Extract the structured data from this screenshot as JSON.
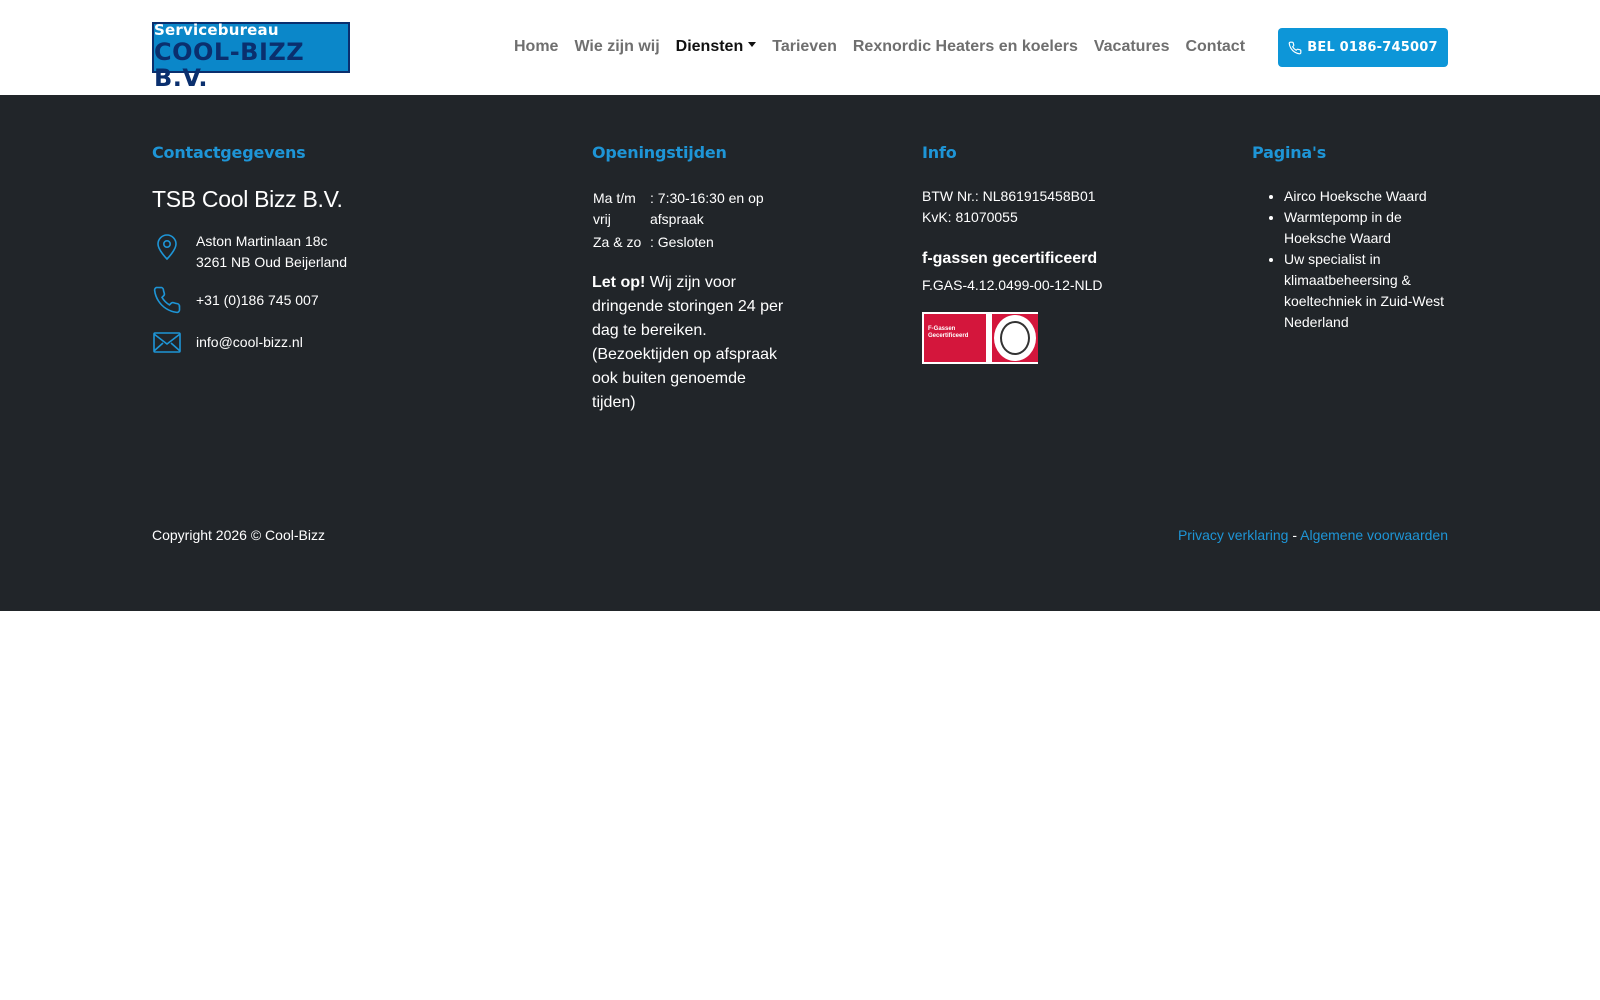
{
  "header": {
    "logo": {
      "line1": "Technisch Servicebureau",
      "line2": "COOL-BIZZ B.V."
    },
    "nav": [
      {
        "label": "Home",
        "active": false
      },
      {
        "label": "Wie zijn wij",
        "active": false
      },
      {
        "label": "Diensten",
        "active": true,
        "dropdown": true
      },
      {
        "label": "Tarieven",
        "active": false
      },
      {
        "label": "Rexnordic Heaters en koelers",
        "active": false
      },
      {
        "label": "Vacatures",
        "active": false
      },
      {
        "label": "Contact",
        "active": false
      }
    ],
    "call_button": "BEL 0186-745007"
  },
  "footer": {
    "contact": {
      "title": "Contactgegevens",
      "company": "TSB Cool Bizz B.V.",
      "address_line1": "Aston Martinlaan 18c",
      "address_line2": "3261 NB Oud Beijerland",
      "phone": "+31 (0)186 745 007",
      "email": "info@cool-bizz.nl"
    },
    "hours": {
      "title": "Openingstijden",
      "rows": [
        {
          "day": "Ma t/m vrij",
          "value": ": 7:30-16:30 en op afspraak"
        },
        {
          "day": "Za & zo",
          "value": ": Gesloten"
        }
      ],
      "note_bold": "Let op!",
      "note": " Wij zijn voor dringende storingen 24 per dag te bereiken. (Bezoektijden op afspraak ook buiten genoemde tijden)"
    },
    "info": {
      "title": "Info",
      "btw": "BTW Nr.: NL861915458B01",
      "kvk": "KvK: 81070055",
      "fgas_title": "f-gassen gecertificeerd",
      "fgas_number": "F.GAS-4.12.0499-00-12-NLD",
      "cert_text": "F-Gassen Gecertificeerd"
    },
    "pages": {
      "title": "Pagina's",
      "items": [
        "Airco Hoeksche Waard",
        "Warmtepomp in de Hoeksche Waard",
        "Uw specialist in klimaatbeheersing & koeltechniek in Zuid-West Nederland"
      ]
    },
    "copyright": "Copyright 2026 © Cool-Bizz",
    "privacy": "Privacy verklaring",
    "separator": " - ",
    "terms": "Algemene voorwaarden"
  },
  "colors": {
    "accent": "#0d96d8",
    "footer_bg": "#212529",
    "logo_dark": "#0a2f6e"
  }
}
